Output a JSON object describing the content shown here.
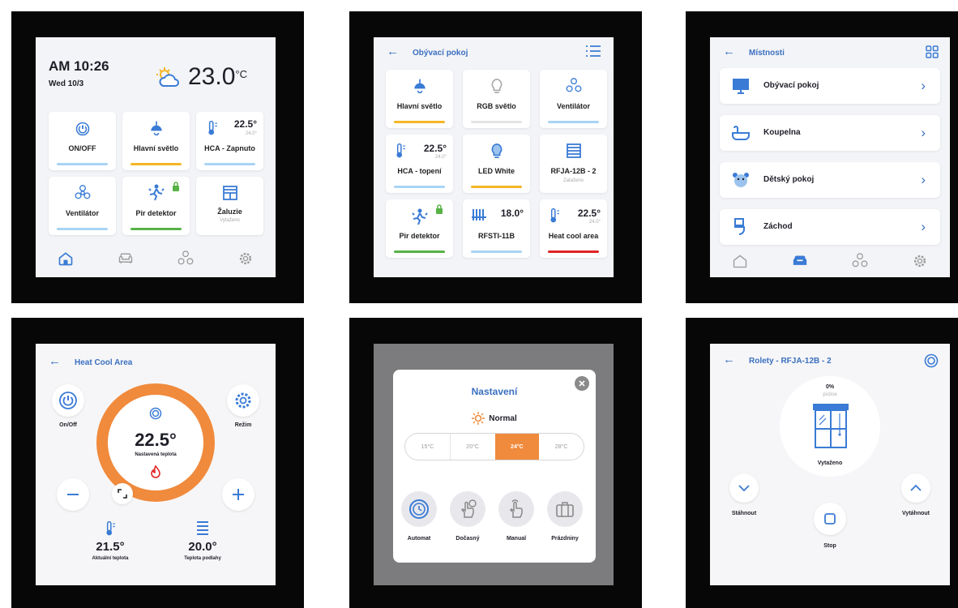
{
  "panel1": {
    "time": "AM 10:26",
    "date": "Wed 10/3",
    "temp": "23.0",
    "temp_unit": "°C",
    "tiles": [
      {
        "label": "ON/OFF",
        "bar": "#a8d4f5"
      },
      {
        "label": "Hlavní světlo",
        "bar": "#f5b625"
      },
      {
        "label": "HCA - Zapnuto",
        "value": "22.5°",
        "sub": "24.0°",
        "bar": "#a8d4f5"
      },
      {
        "label": "Ventilátor",
        "bar": "#a8d4f5"
      },
      {
        "label": "Pir detektor",
        "bar": "#58b246"
      },
      {
        "label": "Žaluzie",
        "sub": "Vytaženo"
      }
    ]
  },
  "panel2": {
    "title": "Obývací pokoj",
    "tiles": [
      {
        "label": "Hlavní světlo",
        "bar": "#f5b625"
      },
      {
        "label": "RGB světlo",
        "bar": "#e4e4e4"
      },
      {
        "label": "Ventilátor",
        "bar": "#a8d4f5"
      },
      {
        "label": "HCA - topení",
        "value": "22.5°",
        "sub": "24.0°",
        "bar": "#a8d4f5"
      },
      {
        "label": "LED White",
        "bar": "#f5b625"
      },
      {
        "label": "RFJA-12B - 2",
        "sub": "Zataženo"
      },
      {
        "label": "Pir detektor",
        "bar": "#58b246"
      },
      {
        "label": "RFSTI-11B",
        "value": "18.0°",
        "bar": "#a8d4f5"
      },
      {
        "label": "Heat cool area",
        "value": "22.5°",
        "sub": "24.0°",
        "bar": "#e02424"
      }
    ]
  },
  "panel3": {
    "title": "Místnosti",
    "rooms": [
      "Obývací pokoj",
      "Koupelna",
      "Dětský pokoj",
      "Záchod"
    ]
  },
  "panel4": {
    "title": "Heat Cool Area",
    "onoff": "On/Off",
    "mode": "Režim",
    "set_temp": "22.5°",
    "set_label": "Nastavená teplota",
    "current_temp": "21.5°",
    "current_label": "Aktuální teplota",
    "floor_temp": "20.0°",
    "floor_label": "Teplota podlahy",
    "accent": "#f08a3c"
  },
  "panel5": {
    "title": "Nastavení",
    "mode": "Normal",
    "temps": [
      "15°C",
      "20°C",
      "24°C",
      "28°C"
    ],
    "selected_temp": "24°C",
    "modes": [
      "Automat",
      "Dočasný",
      "Manual",
      "Prázdniny"
    ],
    "accent": "#f08a3c"
  },
  "panel6": {
    "title": "Rolety - RFJA-12B - 2",
    "percent": "0%",
    "position": "pozice",
    "state": "Vytaženo",
    "down": "Stáhnout",
    "up": "Vytáhnout",
    "stop": "Stop"
  }
}
